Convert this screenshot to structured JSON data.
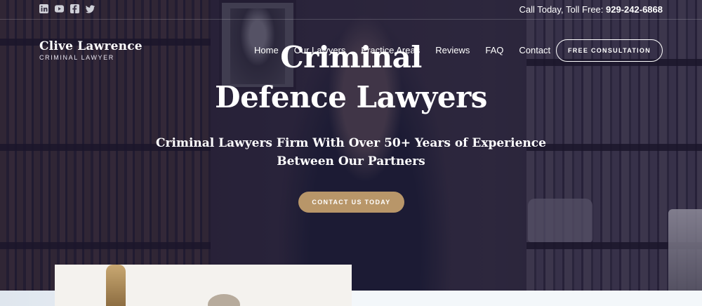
{
  "topbar": {
    "social": [
      {
        "name": "linkedin-icon",
        "glyph": "in"
      },
      {
        "name": "youtube-icon",
        "glyph": "▶"
      },
      {
        "name": "facebook-icon",
        "glyph": "f"
      },
      {
        "name": "twitter-icon",
        "glyph": "t"
      }
    ],
    "call_label": "Call Today, Toll Free:",
    "phone": "929-242-6868"
  },
  "logo": {
    "name": "Clive Lawrence",
    "subtitle": "CRIMINAL LAWYER"
  },
  "nav": {
    "items": [
      {
        "label": "Home"
      },
      {
        "label": "Our Lawyers"
      },
      {
        "label": "Practice Areas"
      },
      {
        "label": "Reviews"
      },
      {
        "label": "FAQ"
      },
      {
        "label": "Contact"
      }
    ],
    "cta_label": "FREE CONSULTATION"
  },
  "hero": {
    "title_line1": "Criminal",
    "title_line2": "Defence Lawyers",
    "subtitle_line1": "Criminal Lawyers Firm With Over 50+ Years of Experience",
    "subtitle_line2": "Between Our Partners",
    "cta_label": "CONTACT US TODAY"
  },
  "colors": {
    "accent_gold": "#b89669",
    "overlay": "#1e1837"
  }
}
